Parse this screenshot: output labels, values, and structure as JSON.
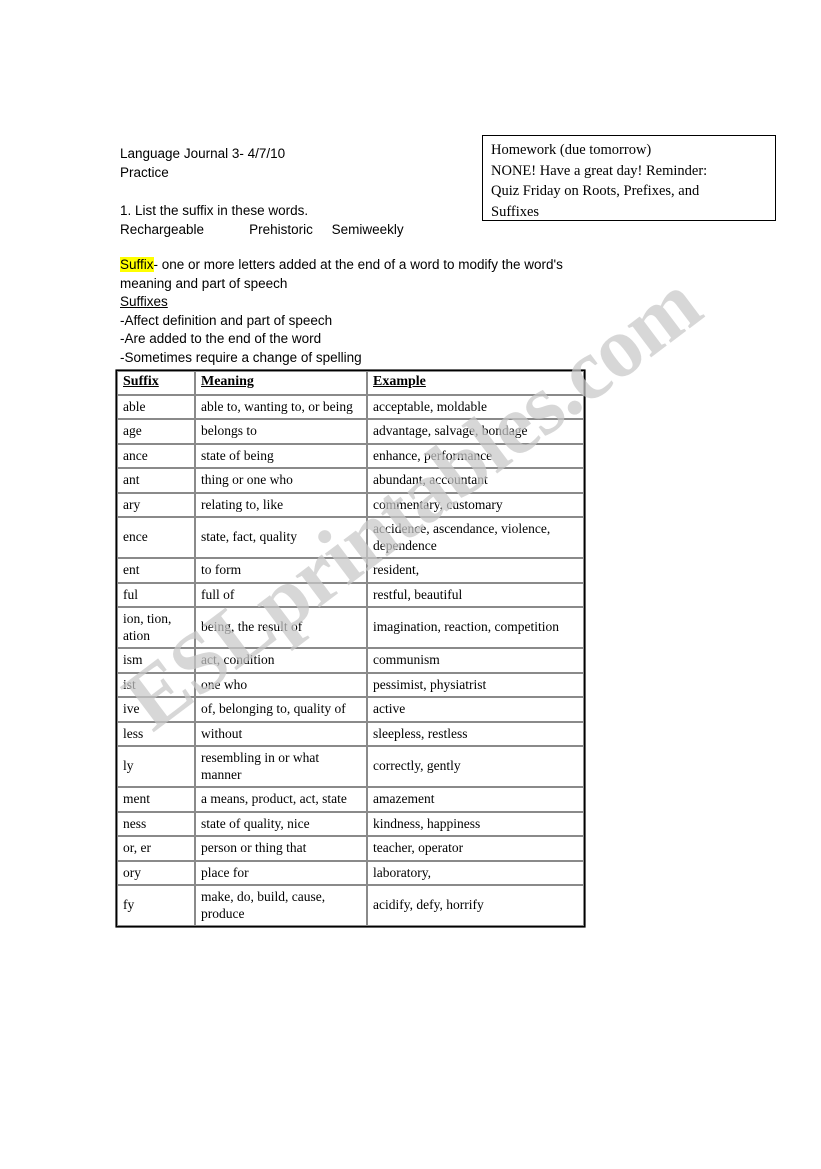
{
  "header": {
    "title_line1": "Language Journal 3- 4/7/10",
    "title_line2": "Practice",
    "question": "1. List the suffix in these words.",
    "words_line": "Rechargeable            Prehistoric     Semiweekly"
  },
  "homework": {
    "line1": "Homework (due tomorrow)",
    "line2": "NONE! Have a great day! Reminder:",
    "line3": "Quiz Friday on Roots, Prefixes, and",
    "line4": "Suffixes"
  },
  "definition": {
    "highlight_word": "Suffix",
    "highlight_color": "#ffff00",
    "definition_text": "- one or more letters added at the end of a word to modify the word's meaning and part of speech",
    "subheading": "Suffixes",
    "bullets": [
      "-Affect definition and part of speech",
      "-Are added to the end of the word",
      "-Sometimes require a change of spelling"
    ]
  },
  "table": {
    "headers": [
      "Suffix",
      "Meaning",
      "Example"
    ],
    "rows": [
      {
        "suffix": " able",
        "meaning": "able to, wanting to, or being",
        "example": "acceptable, moldable"
      },
      {
        "suffix": "age",
        "meaning": "belongs to",
        "example": "advantage, salvage, bondage"
      },
      {
        "suffix": "ance",
        "meaning": "state of being",
        "example": "enhance, performance"
      },
      {
        "suffix": "ant",
        "meaning": "thing or one who",
        "example": "abundant, accountant"
      },
      {
        "suffix": "ary",
        "meaning": "relating to, like",
        "example": "commentary, customary"
      },
      {
        "suffix": "ence",
        "meaning": "state, fact, quality",
        "example": "accidence, ascendance, violence, dependence"
      },
      {
        "suffix": "ent",
        "meaning": "to form",
        "example": "resident,"
      },
      {
        "suffix": "ful",
        "meaning": "full of",
        "example": "restful, beautiful"
      },
      {
        "suffix": "ion, tion, ation",
        "meaning": "being, the result of",
        "example": "imagination, reaction, competition"
      },
      {
        "suffix": "ism",
        "meaning": "act, condition",
        "example": "communism"
      },
      {
        "suffix": "ist",
        "meaning": "one who",
        "example": "pessimist, physiatrist"
      },
      {
        "suffix": "ive",
        "meaning": "of, belonging to, quality of",
        "example": "active"
      },
      {
        "suffix": "less",
        "meaning": "without",
        "example": "sleepless, restless"
      },
      {
        "suffix": "ly",
        "meaning": "resembling in or what manner",
        "example": "correctly, gently"
      },
      {
        "suffix": "ment",
        "meaning": "a means, product, act, state",
        "example": "amazement"
      },
      {
        "suffix": "ness",
        "meaning": "state of quality, nice",
        "example": "kindness, happiness"
      },
      {
        "suffix": "or, er",
        "meaning": "person or thing that",
        "example": " teacher, operator"
      },
      {
        "suffix": "ory",
        "meaning": "place for",
        "example": "laboratory,"
      },
      {
        "suffix": "fy",
        "meaning": "make, do, build, cause, produce",
        "example": "acidify, defy, horrify"
      }
    ]
  },
  "watermark": {
    "text": "ESLprintables.com",
    "color": "#c9c9c9"
  }
}
